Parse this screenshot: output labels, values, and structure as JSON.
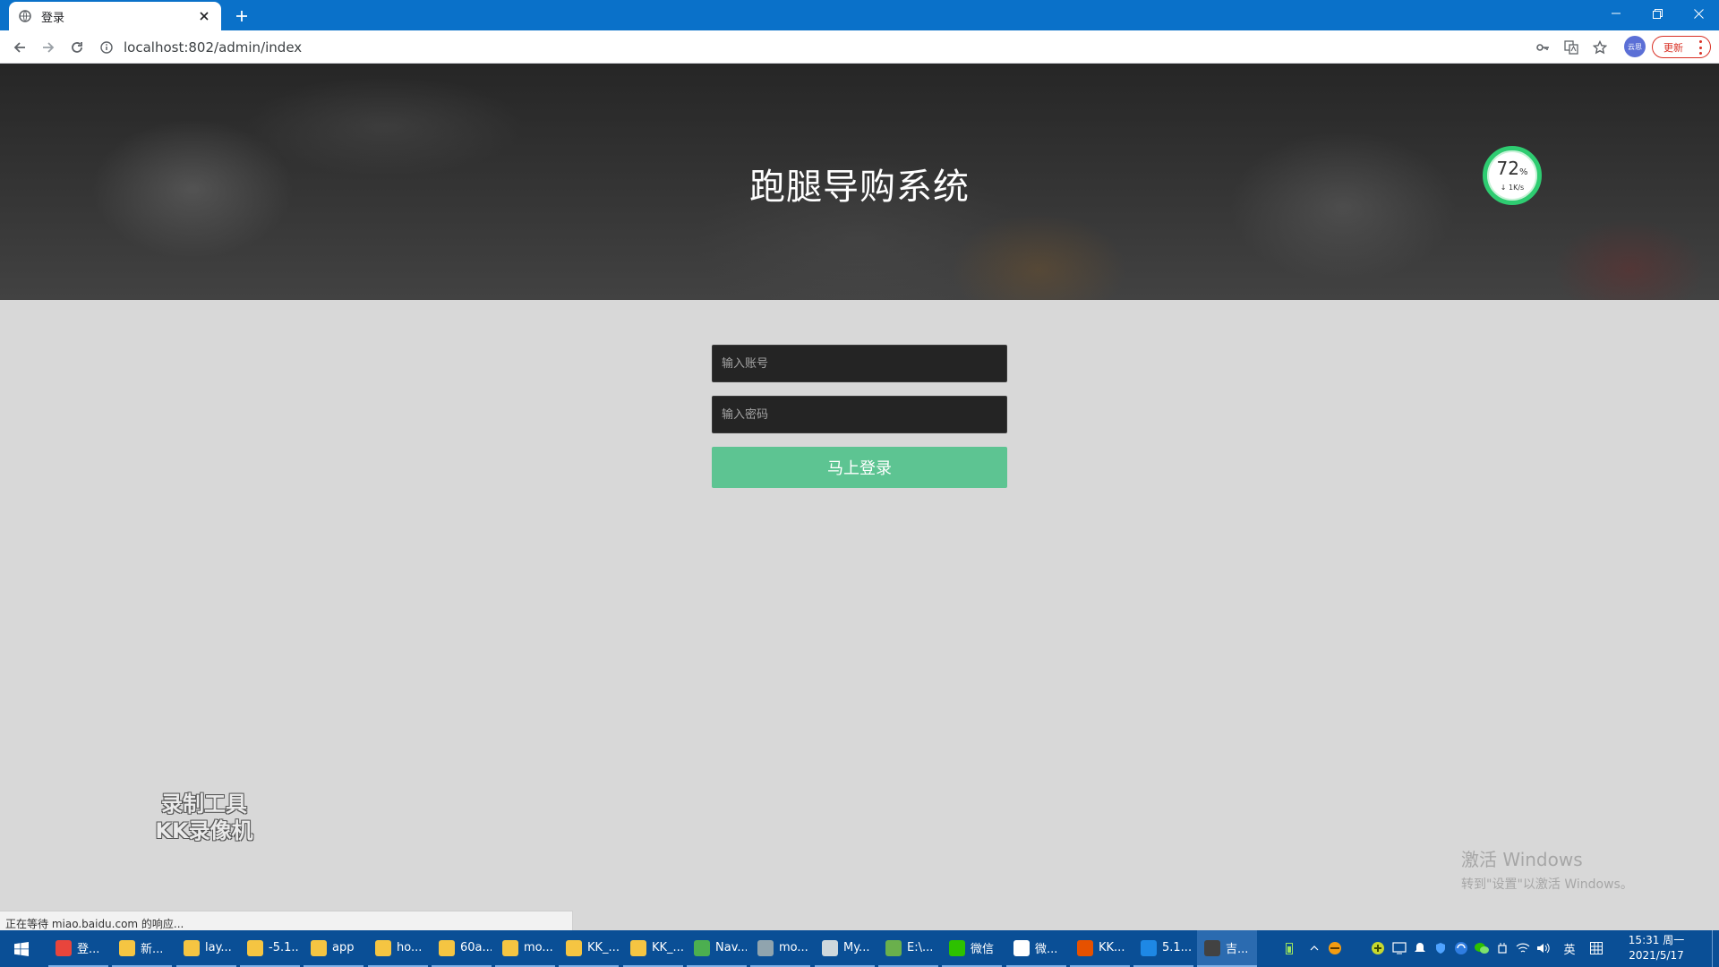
{
  "browser": {
    "tab_title": "登录",
    "url": "localhost:802/admin/index",
    "avatar_text": "云思",
    "update_label": "更新",
    "status_text": "正在等待 miao.baidu.com 的响应..."
  },
  "page": {
    "title": "跑腿导购系统",
    "form": {
      "account_placeholder": "输入账号",
      "password_placeholder": "输入密码",
      "login_label": "马上登录"
    }
  },
  "widget": {
    "percent": "72",
    "percent_unit": "%",
    "speed": "1K/s"
  },
  "watermarks": {
    "recorder_line1": "录制工具",
    "recorder_line2": "KK录像机",
    "activate_line1": "激活 Windows",
    "activate_line2": "转到\"设置\"以激活 Windows。"
  },
  "taskbar": {
    "items": [
      {
        "label": "登...",
        "color": "#e8453c"
      },
      {
        "label": "新...",
        "color": "#f5c542"
      },
      {
        "label": "lay...",
        "color": "#f5c542"
      },
      {
        "label": "-5.1...",
        "color": "#f5c542"
      },
      {
        "label": "app",
        "color": "#f5c542"
      },
      {
        "label": "ho...",
        "color": "#f5c542"
      },
      {
        "label": "60a...",
        "color": "#f5c542"
      },
      {
        "label": "mo...",
        "color": "#f5c542"
      },
      {
        "label": "KK_...",
        "color": "#f5c542"
      },
      {
        "label": "KK_...",
        "color": "#f5c542"
      },
      {
        "label": "Nav...",
        "color": "#4caf50"
      },
      {
        "label": "mo...",
        "color": "#90a4ae"
      },
      {
        "label": "My...",
        "color": "#cfd8dc"
      },
      {
        "label": "E:\\...",
        "color": "#6ab04c"
      },
      {
        "label": "微信",
        "color": "#2dc100"
      },
      {
        "label": "微...",
        "color": "#ffffff"
      },
      {
        "label": "KK...",
        "color": "#e65100"
      },
      {
        "label": "5.1...",
        "color": "#1e88e5"
      },
      {
        "label": "吉...",
        "color": "#424242"
      }
    ],
    "ime_label": "英",
    "time": "15:31 周一",
    "date": "2021/5/17"
  }
}
